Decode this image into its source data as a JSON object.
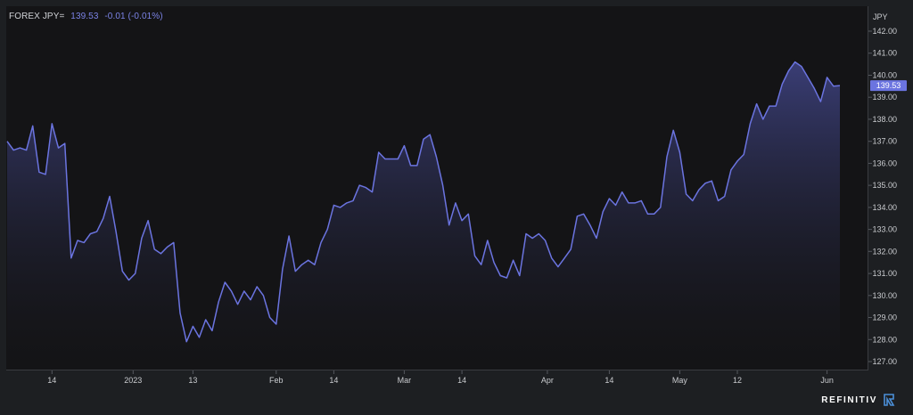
{
  "header": {
    "symbol": "FOREX JPY=",
    "last": "139.53",
    "change": "-0.01 (-0.01%)"
  },
  "brand": {
    "name": "REFINITIV",
    "logo_icon": "refinitiv-logo-icon"
  },
  "colors": {
    "background": "#1d1f22",
    "plot_background": "#141416",
    "line": "#6b74e0",
    "fill_top": "#3e4280",
    "badge": "#6b74e0",
    "axis_text": "#c9cbcf",
    "grid": "#26282c"
  },
  "chart_data": {
    "type": "area",
    "title": "",
    "xlabel": "",
    "ylabel": "JPY",
    "ylim": [
      126.5,
      142.6
    ],
    "yticks": [
      127,
      128,
      129,
      130,
      131,
      132,
      133,
      134,
      135,
      136,
      137,
      138,
      139,
      140,
      141,
      142
    ],
    "xtick_labels": [
      {
        "label": "14",
        "x": "2022-12-14"
      },
      {
        "label": "2023",
        "x": "2023-01-01"
      },
      {
        "label": "13",
        "x": "2023-01-13"
      },
      {
        "label": "Feb",
        "x": "2023-02-01"
      },
      {
        "label": "14",
        "x": "2023-02-14"
      },
      {
        "label": "Mar",
        "x": "2023-03-01"
      },
      {
        "label": "14",
        "x": "2023-03-14"
      },
      {
        "label": "Apr",
        "x": "2023-04-01"
      },
      {
        "label": "14",
        "x": "2023-04-14"
      },
      {
        "label": "May",
        "x": "2023-05-01"
      },
      {
        "label": "12",
        "x": "2023-05-12"
      },
      {
        "label": "Jun",
        "x": "2023-06-01"
      }
    ],
    "last_value_label": "139.53",
    "grid": false,
    "series": [
      {
        "x": [
          "2022-12-05",
          "2022-12-06",
          "2022-12-07",
          "2022-12-08",
          "2022-12-09",
          "2022-12-12",
          "2022-12-13",
          "2022-12-14",
          "2022-12-15",
          "2022-12-16",
          "2022-12-19",
          "2022-12-20",
          "2022-12-21",
          "2022-12-22",
          "2022-12-23",
          "2022-12-26",
          "2022-12-27",
          "2022-12-28",
          "2022-12-29",
          "2022-12-30",
          "2023-01-02",
          "2023-01-03",
          "2023-01-04",
          "2023-01-05",
          "2023-01-06",
          "2023-01-09",
          "2023-01-10",
          "2023-01-11",
          "2023-01-12",
          "2023-01-13",
          "2023-01-16",
          "2023-01-17",
          "2023-01-18",
          "2023-01-19",
          "2023-01-20",
          "2023-01-23",
          "2023-01-24",
          "2023-01-25",
          "2023-01-26",
          "2023-01-27",
          "2023-01-30",
          "2023-01-31",
          "2023-02-01",
          "2023-02-02",
          "2023-02-03",
          "2023-02-06",
          "2023-02-07",
          "2023-02-08",
          "2023-02-09",
          "2023-02-10",
          "2023-02-13",
          "2023-02-14",
          "2023-02-15",
          "2023-02-16",
          "2023-02-17",
          "2023-02-20",
          "2023-02-21",
          "2023-02-22",
          "2023-02-23",
          "2023-02-24",
          "2023-02-27",
          "2023-02-28",
          "2023-03-01",
          "2023-03-02",
          "2023-03-03",
          "2023-03-06",
          "2023-03-07",
          "2023-03-08",
          "2023-03-09",
          "2023-03-10",
          "2023-03-13",
          "2023-03-14",
          "2023-03-15",
          "2023-03-16",
          "2023-03-17",
          "2023-03-20",
          "2023-03-21",
          "2023-03-22",
          "2023-03-23",
          "2023-03-24",
          "2023-03-27",
          "2023-03-28",
          "2023-03-29",
          "2023-03-30",
          "2023-03-31",
          "2023-04-03",
          "2023-04-04",
          "2023-04-05",
          "2023-04-06",
          "2023-04-07",
          "2023-04-10",
          "2023-04-11",
          "2023-04-12",
          "2023-04-13",
          "2023-04-14",
          "2023-04-17",
          "2023-04-18",
          "2023-04-19",
          "2023-04-20",
          "2023-04-21",
          "2023-04-24",
          "2023-04-25",
          "2023-04-26",
          "2023-04-27",
          "2023-04-28",
          "2023-05-01",
          "2023-05-02",
          "2023-05-03",
          "2023-05-04",
          "2023-05-05",
          "2023-05-08",
          "2023-05-09",
          "2023-05-10",
          "2023-05-11",
          "2023-05-12",
          "2023-05-15",
          "2023-05-16",
          "2023-05-17",
          "2023-05-18",
          "2023-05-19",
          "2023-05-22",
          "2023-05-23",
          "2023-05-24",
          "2023-05-25",
          "2023-05-26",
          "2023-05-29",
          "2023-05-30",
          "2023-05-31",
          "2023-06-01",
          "2023-06-02",
          "2023-06-05"
        ],
        "y": [
          137.0,
          136.6,
          136.7,
          136.6,
          137.7,
          135.6,
          135.5,
          137.8,
          136.7,
          136.9,
          131.7,
          132.5,
          132.4,
          132.8,
          132.9,
          133.5,
          134.5,
          132.9,
          131.1,
          130.7,
          131.0,
          132.6,
          133.4,
          132.1,
          131.9,
          132.2,
          132.4,
          129.2,
          127.9,
          128.6,
          128.1,
          128.9,
          128.4,
          129.7,
          130.6,
          130.2,
          129.6,
          130.2,
          129.8,
          130.4,
          130.0,
          129.0,
          128.7,
          131.2,
          132.7,
          131.1,
          131.4,
          131.6,
          131.4,
          132.4,
          133.0,
          134.1,
          134.0,
          134.2,
          134.3,
          135.0,
          134.9,
          134.7,
          136.5,
          136.2,
          136.2,
          136.2,
          136.8,
          135.9,
          135.9,
          137.1,
          137.3,
          136.3,
          135.0,
          133.2,
          134.2,
          133.4,
          133.7,
          131.8,
          131.4,
          132.5,
          131.5,
          130.9,
          130.8,
          131.6,
          130.9,
          132.8,
          132.6,
          132.8,
          132.5,
          131.7,
          131.3,
          131.7,
          132.1,
          133.6,
          133.7,
          133.2,
          132.6,
          133.8,
          134.4,
          134.1,
          134.7,
          134.2,
          134.2,
          134.3,
          133.7,
          133.7,
          134.0,
          136.3,
          137.5,
          136.5,
          134.6,
          134.3,
          134.8,
          135.1,
          135.2,
          134.3,
          134.5,
          135.7,
          136.1,
          136.4,
          137.8,
          138.7,
          138.0,
          138.6,
          138.6,
          139.6,
          140.2,
          140.6,
          140.4,
          139.9,
          139.4,
          138.8,
          139.9,
          139.5,
          139.53
        ]
      }
    ]
  }
}
